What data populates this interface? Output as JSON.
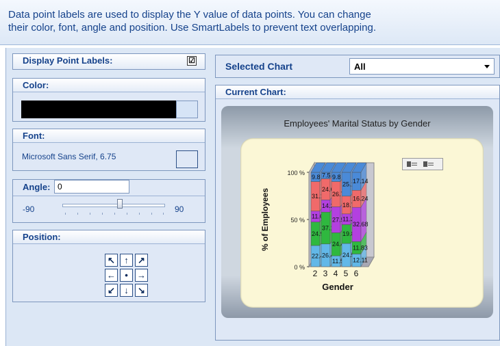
{
  "description": {
    "line1": "Data point labels are used to display the Y value of data points. You can change",
    "line2": "their color, font, angle and position. Use SmartLabels to prevent text overlapping."
  },
  "display_point_labels": {
    "label": "Display Point Labels:",
    "checked": "☑"
  },
  "color": {
    "label": "Color:"
  },
  "font": {
    "label": "Font:",
    "value": "Microsoft Sans Serif, 6.75"
  },
  "angle": {
    "label": "Angle:",
    "value": "0",
    "min": "-90",
    "max": "90"
  },
  "position": {
    "label": "Position:",
    "arrows": [
      "↖",
      "↑",
      "↗",
      "←",
      "•",
      "→",
      "↙",
      "↓",
      "↘"
    ]
  },
  "selected_chart": {
    "label": "Selected Chart",
    "value": "All"
  },
  "current_chart": {
    "label": "Current Chart:"
  },
  "chart_data": {
    "type": "bar",
    "title": "Employees' Marital Status by Gender",
    "xlabel": "Gender",
    "ylabel": "% of Employees",
    "yticks": [
      "0 %",
      "50 %",
      "100 %"
    ],
    "categories": [
      "2",
      "3",
      "4",
      "5",
      "6"
    ],
    "stacked": "100% 3D",
    "series": [
      {
        "color": "#62b8e8",
        "values": [
          22.4,
          26.44,
          11.53,
          24.5,
          12.11
        ]
      },
      {
        "color": "#2fb83f",
        "values": [
          24.9,
          37.1,
          24.41,
          19.85,
          11.83
        ]
      },
      {
        "color": "#b340e0",
        "values": [
          11.6,
          14.2,
          27.5,
          11.3,
          32.68
        ]
      },
      {
        "color": "#f06a6a",
        "values": [
          31.1,
          24.6,
          26.7,
          18.73,
          16.24
        ]
      },
      {
        "color": "#4a8ad8",
        "values": [
          9.8,
          7.5,
          9.8,
          25.1,
          17.14
        ]
      }
    ],
    "data_labels": [
      [
        "22.4",
        "26.44",
        "11.53",
        "24.5",
        "12.11"
      ],
      [
        "24.9",
        "37.1",
        "24.41",
        "19.85",
        "11.83"
      ],
      [
        "11.6",
        "14.2",
        "27.5",
        "11.3",
        "32.68"
      ],
      [
        "31.1",
        "24.6",
        "26.7",
        "18.73",
        "16.24"
      ],
      [
        "9.8",
        "7.5",
        "9.8",
        "25.1",
        "17.14"
      ]
    ]
  }
}
